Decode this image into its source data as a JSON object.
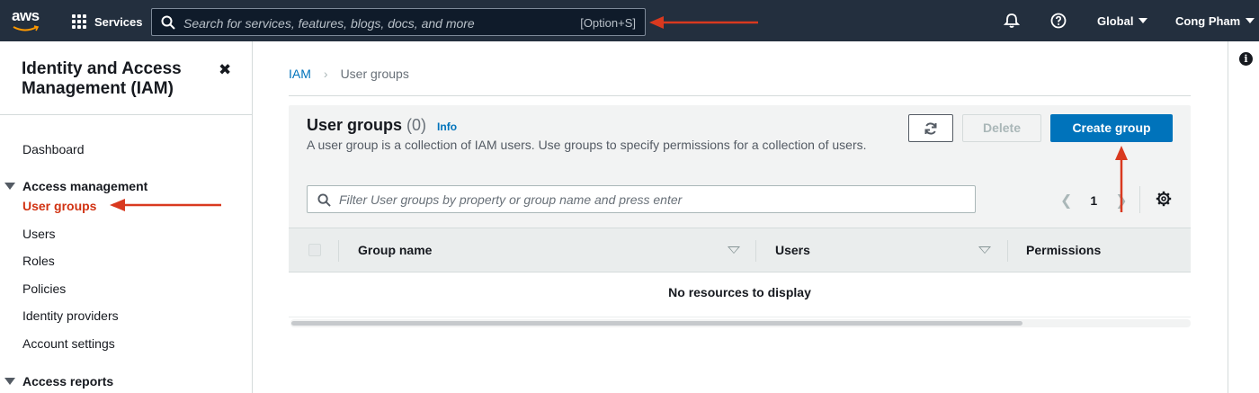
{
  "topnav": {
    "logo_text": "aws",
    "services_label": "Services",
    "search_placeholder": "Search for services, features, blogs, docs, and more",
    "search_shortcut": "[Option+S]",
    "region_label": "Global",
    "user_label": "Cong Pham",
    "icons": [
      "grid-icon",
      "search-icon",
      "bell-icon",
      "help-icon"
    ],
    "background_color": "#232f3e"
  },
  "sidebar": {
    "title": "Identity and Access Management (IAM)",
    "close_symbol": "✖",
    "dashboard_label": "Dashboard",
    "access_management": {
      "label": "Access management",
      "items": [
        "User groups",
        "Users",
        "Roles",
        "Policies",
        "Identity providers",
        "Account settings"
      ],
      "active": "User groups"
    },
    "access_reports_label": "Access reports",
    "active_color": "#d13212"
  },
  "breadcrumb": {
    "root": "IAM",
    "current": "User groups"
  },
  "user_groups": {
    "title": "User groups",
    "count": "(0)",
    "info_label": "Info",
    "description": "A user group is a collection of IAM users. Use groups to specify permissions for a collection of users.",
    "delete_label": "Delete",
    "create_label": "Create group",
    "filter_placeholder": "Filter User groups by property or group name and press enter",
    "page_number": "1",
    "columns": [
      "Group name",
      "Users",
      "Permissions"
    ],
    "empty_message": "No resources to display",
    "primary_color": "#0073bb"
  },
  "annotations": {
    "arrow_color": "#d9391f"
  }
}
